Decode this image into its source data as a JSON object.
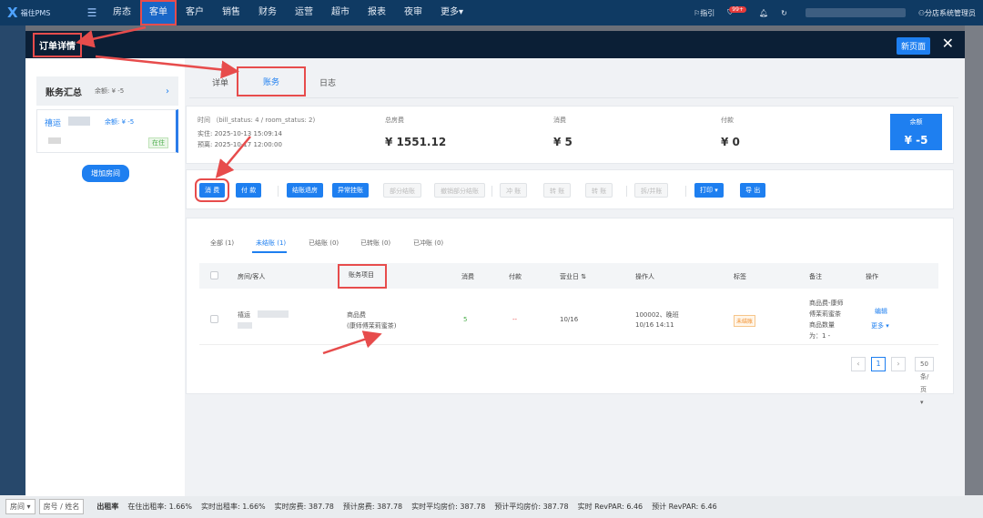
{
  "nav": {
    "logo_text": "福住PMS",
    "items": [
      "房态",
      "客单",
      "客户",
      "销售",
      "财务",
      "运营",
      "超市",
      "报表",
      "夜审",
      "更多▾"
    ],
    "right": {
      "flag_label": "指引",
      "badge": "99+",
      "user": "分店系统管理员"
    }
  },
  "modal": {
    "title": "订单详情",
    "new_page": "新页面",
    "close": "✕"
  },
  "left": {
    "summary_title": "账务汇总",
    "summary_balance": "余额: ¥ -5",
    "room_name": "禧运",
    "room_balance": "余额: ¥ -5",
    "room_status": "在住",
    "add_room": "增加房间"
  },
  "tabs": [
    "详单",
    "账务",
    "日志"
  ],
  "info": {
    "time_label": "时间 （bill_status: 4 / room_status: 2)",
    "checkin": "实住: 2025-10-13 15:09:14",
    "checkout": "预离: 2025-10-17 12:00:00",
    "total_room_label": "总房费",
    "total_room": "¥ 1551.12",
    "consume_label": "消费",
    "consume": "¥ 5",
    "pay_label": "付款",
    "pay": "¥ 0",
    "balance_label": "余额",
    "balance": "¥ -5"
  },
  "toolbar": {
    "consume": "消 费",
    "pay": "付 款",
    "checkout_room": "结账退房",
    "abnormal": "异常挂账",
    "partial": "部分结账",
    "cancel_partial": "撤销部分结账",
    "offset": "冲 账",
    "transfer_in": "转 账",
    "transfer": "转 账",
    "split": "拆/并账",
    "print": "打印 ▾",
    "export": "导 出"
  },
  "filters": [
    "全部 (1)",
    "未结账 (1)",
    "已结账 (0)",
    "已转账 (0)",
    "已冲账 (0)"
  ],
  "table": {
    "headers": [
      "房间/客人",
      "账务项目",
      "消费",
      "付款",
      "营业日 ⇅",
      "操作人",
      "标签",
      "备注",
      "操作"
    ],
    "row": {
      "room": "禧运",
      "item_line1": "商品费",
      "item_line2": "(康师傅茉莉蜜茶)",
      "consume": "5",
      "pay": "--",
      "biz_date": "10/16",
      "operator_line1": "100002、晚班",
      "operator_line2": "10/16 14:11",
      "tag": "未结账",
      "note_line1": "商品费-康师",
      "note_line2": "傅茉莉蜜茶",
      "note_line3": "商品数量",
      "note_line4": "为：1 -",
      "action_edit": "编辑",
      "action_more": "更多 ▾"
    }
  },
  "pager": {
    "prev": "‹",
    "page": "1",
    "next": "›",
    "size": "50 条/页 ▾"
  },
  "footer": {
    "select1": "房间 ▾",
    "select2": "房号 / 姓名",
    "stats": [
      "出租率",
      "在住出租率: 1.66%",
      "实时出租率: 1.66%",
      "实时房费: 387.78",
      "预计房费: 387.78",
      "实时平均房价: 387.78",
      "预计平均房价: 387.78",
      "实时 RevPAR: 6.46",
      "预计 RevPAR: 6.46"
    ]
  },
  "colors": {
    "nav_bg": "#0f3a63",
    "primary": "#1e7ff0",
    "annotation": "#e74c4c"
  }
}
